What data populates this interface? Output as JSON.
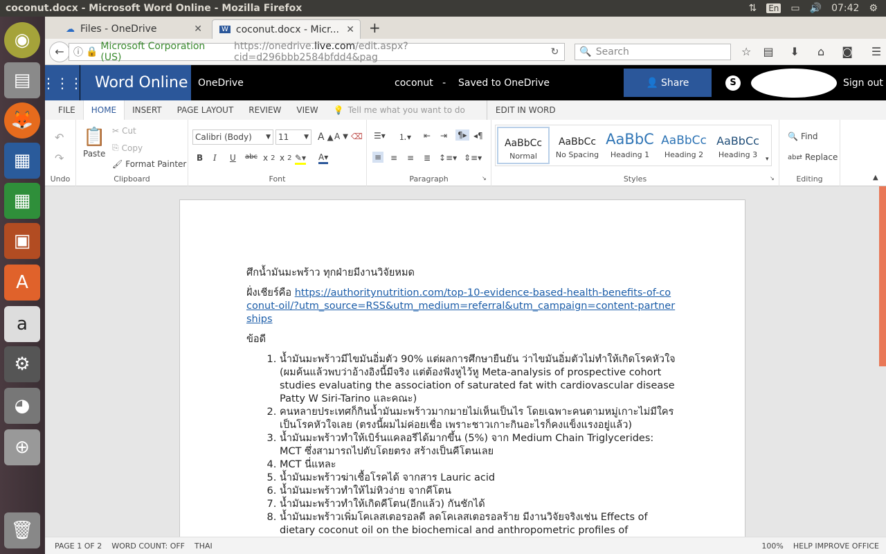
{
  "os": {
    "window_title": "coconut.docx - Microsoft Word Online - Mozilla Firefox",
    "lang": "En",
    "clock": "07:42"
  },
  "browser": {
    "tabs": [
      {
        "label": "Files - OneDrive"
      },
      {
        "label": "coconut.docx - Micr..."
      }
    ],
    "secure_label": "Microsoft Corporation (US)",
    "url_prefix": "https://onedrive.",
    "url_host": "live.com",
    "url_rest": "/edit.aspx?cid=d296bbb2584bfdd4&pag",
    "search_placeholder": "Search"
  },
  "word": {
    "app_name": "Word Online",
    "onedrive": "OneDrive",
    "doc_name": "coconut",
    "separator": "-",
    "save_status": "Saved to OneDrive",
    "share": "Share",
    "sign_out": "Sign out"
  },
  "ribbon": {
    "tabs": [
      "FILE",
      "HOME",
      "INSERT",
      "PAGE LAYOUT",
      "REVIEW",
      "VIEW"
    ],
    "tell_me": "Tell me what you want to do",
    "edit_in_word": "EDIT IN WORD",
    "undo_group": "Undo",
    "clipboard": {
      "paste": "Paste",
      "cut": "Cut",
      "copy": "Copy",
      "format_painter": "Format Painter",
      "label": "Clipboard"
    },
    "font": {
      "family": "Calibri (Body)",
      "size": "11",
      "label": "Font"
    },
    "paragraph": {
      "label": "Paragraph"
    },
    "styles": {
      "label": "Styles",
      "items": [
        {
          "preview": "AaBbCc",
          "name": "Normal"
        },
        {
          "preview": "AaBbCc",
          "name": "No Spacing"
        },
        {
          "preview": "AaBbC",
          "name": "Heading 1"
        },
        {
          "preview": "AaBbCc",
          "name": "Heading 2"
        },
        {
          "preview": "AaBbCc",
          "name": "Heading 3"
        }
      ]
    },
    "editing": {
      "find": "Find",
      "replace": "Replace",
      "label": "Editing"
    }
  },
  "document": {
    "heading": "ศึกน้ำมันมะพร้าว ทุกฝ่ายมีงานวิจัยหมด",
    "cheer_prefix": "ฝั่งเชียร์คือ ",
    "cheer_link": "https://authoritynutrition.com/top-10-evidence-based-health-benefits-of-coconut-oil/?utm_source=RSS&utm_medium=referral&utm_campaign=content-partnerships",
    "pros_label": "ข้อดี",
    "items": [
      "น้ำมันมะพร้าวมีไขมันอิ่มตัว 90% แต่ผลการศึกษายืนยัน ว่าไขมันอิ่มตัวไม่ทำให้เกิดโรคหัวใจ (ผมค้นแล้วพบว่าอ้างอิงนี้มีจริง แต่ต้องฟังหูไว้หู Meta-analysis of prospective cohort studies evaluating the association of saturated fat with cardiovascular disease  Patty W Siri-Tarino และคณะ)",
      "คนหลายประเทศก็กินน้ำมันมะพร้าวมากมายไม่เห็นเป็นไร โดยเฉพาะคนตามหมู่เกาะไม่มีใครเป็นโรคหัวใจเลย (ตรงนี้ผมไม่ค่อยเชื่อ เพราะชาวเกาะกินอะไรก็คงแข็งแรงอยู่แล้ว)",
      "น้ำมันมะพร้าวทำให้เบิร์นแคลอรีได้มากขึ้น (5%) จาก Medium Chain Triglycerides: MCT  ซึ่งสามารถไปตับโดยตรง สร้างเป็นคีโตนเลย",
      "MCT นี่แหละ",
      "น้ำมันมะพร้าวฆ่าเชื้อโรคได้ จากสาร Lauric acid",
      "น้ำมันมะพร้าวทำให้ไม่หิวง่าย จากคีโตน",
      "น้ำมันมะพร้าวทำให้เกิดคีโตน(อีกแล้ว) กันชักได้",
      "น้ำมันมะพร้าวเพิ่มโคเลสเตอรอลดี ลดโคเลสเตอรอลร้าย มีงานวิจัยจริงเช่น Effects of dietary coconut oil on the biochemical and anthropometric profiles of"
    ]
  },
  "status": {
    "page": "PAGE 1 OF 2",
    "word_count": "WORD COUNT: OFF",
    "language": "THAI",
    "zoom": "100%",
    "help": "HELP IMPROVE OFFICE"
  }
}
